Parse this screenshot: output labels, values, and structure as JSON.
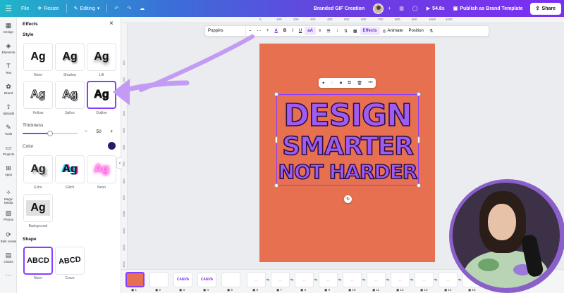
{
  "topbar": {
    "menu_icon": "hamburger-icon",
    "file": "File",
    "resize": "Resize",
    "editing": "Editing",
    "title": "Branded GIF Creation",
    "timer": "54.8s",
    "publish": "Publish as Brand Template",
    "share": "Share"
  },
  "rail": [
    {
      "label": "Design",
      "icon": "design-icon"
    },
    {
      "label": "Elements",
      "icon": "elements-icon"
    },
    {
      "label": "Text",
      "icon": "text-icon"
    },
    {
      "label": "Brand",
      "icon": "brand-icon"
    },
    {
      "label": "Uploads",
      "icon": "upload-icon"
    },
    {
      "label": "Tools",
      "icon": "tools-icon"
    },
    {
      "label": "Projects",
      "icon": "folder-icon"
    },
    {
      "label": "Apps",
      "icon": "apps-icon"
    },
    {
      "label": "Magic Media",
      "icon": "magic-media-icon"
    },
    {
      "label": "Photos",
      "icon": "photos-icon"
    },
    {
      "label": "Bulk create",
      "icon": "bulk-create-icon"
    },
    {
      "label": "Charts",
      "icon": "charts-icon"
    }
  ],
  "panel": {
    "title": "Effects",
    "style_label": "Style",
    "styles": [
      "None",
      "Shadow",
      "Lift",
      "Hollow",
      "Splice",
      "Outline",
      "Echo",
      "Glitch",
      "Neon",
      "Background"
    ],
    "sample": "Ag",
    "selected_style": "Outline",
    "thickness_label": "Thickness",
    "thickness": "50",
    "thickness_fraction": 0.5,
    "minus": "−",
    "plus": "+",
    "color_label": "Color",
    "color_value": "#2a1b6a",
    "shape_label": "Shape",
    "shape_sample": "ABCD",
    "shapes": [
      "None",
      "Curve"
    ]
  },
  "textbar": {
    "font": "Poppins",
    "size_minus": "–",
    "size_value": "- -",
    "size_plus": "+",
    "color_glyph": "A",
    "bold": "B",
    "italic": "I",
    "underline": "U",
    "case": "aA",
    "effects": "Effects",
    "animate": "Animate",
    "position": "Position"
  },
  "ruler_top": [
    "0",
    "100",
    "200",
    "300",
    "400",
    "500",
    "600",
    "700",
    "800",
    "900",
    "1000",
    "1100"
  ],
  "ruler_left": [
    "100",
    "200",
    "300",
    "400",
    "500",
    "600",
    "700",
    "800",
    "900",
    "1000",
    "1100",
    "1200",
    "1300"
  ],
  "design": {
    "line1": "DESIGN",
    "line2": "SMARTER",
    "line3": "NOT HARDER",
    "bg_color": "#e77050",
    "text_color": "#9e5cf0",
    "stroke_color": "#2a0f4a"
  },
  "filmstrip": {
    "pages": [
      {
        "num": "1",
        "thumb": ""
      },
      {
        "num": "2",
        "thumb": ""
      },
      {
        "num": "3",
        "thumb": "CANVA"
      },
      {
        "num": "4",
        "thumb": "CANVA"
      },
      {
        "num": "5",
        "thumb": ""
      },
      {
        "num": "6",
        "thumb": "..."
      },
      {
        "num": "7",
        "thumb": "..."
      },
      {
        "num": "8",
        "thumb": "..."
      },
      {
        "num": "9",
        "thumb": "..."
      },
      {
        "num": "10",
        "thumb": "..."
      },
      {
        "num": "11",
        "thumb": "..."
      },
      {
        "num": "12",
        "thumb": "..."
      },
      {
        "num": "13",
        "thumb": "..."
      },
      {
        "num": "14",
        "thumb": "..."
      },
      {
        "num": "15",
        "thumb": "..."
      },
      {
        "num": "18",
        "thumb": "..."
      }
    ]
  },
  "colors": {
    "accent": "#8b3dff",
    "arrow": "#c39bf5"
  }
}
